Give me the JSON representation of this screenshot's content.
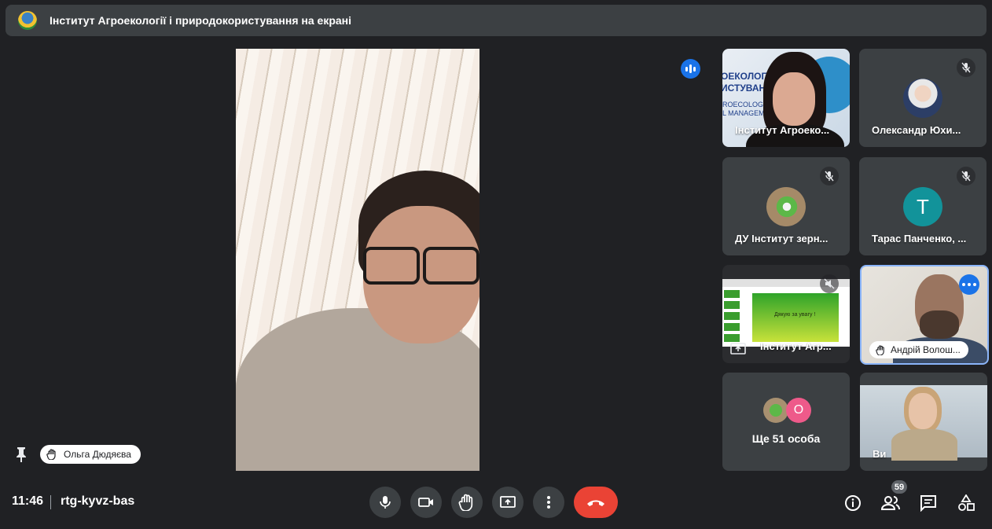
{
  "banner": {
    "title": "Інститут Агроекології і природокористування на екрані"
  },
  "main_speaker": {
    "name": "Ольга Дюдяєва"
  },
  "tiles": [
    {
      "name": "Інститут Агроеко...",
      "muted": false,
      "org_text": [
        "ОЕКОЛОГІ",
        "ИСТУВАНН"
      ],
      "org_text_en": [
        "ROECOLOGY",
        "L MANAGEMENT"
      ]
    },
    {
      "name": "Олександр Юхи...",
      "muted": true
    },
    {
      "name": "ДУ Інститут зерн...",
      "muted": true
    },
    {
      "name": "Тарас Панченко, ...",
      "muted": true,
      "avatar_letter": "T"
    },
    {
      "name": "Інститут Агр...",
      "muted": true,
      "presenting": true,
      "slide_text": "Дякую за увагу !"
    },
    {
      "name": "Андрій Волош...",
      "hand_raised": true
    },
    {
      "more_label": "Ще 51 особа",
      "avatar_letter": "О"
    },
    {
      "name": "Ви"
    }
  ],
  "meeting": {
    "time": "11:46",
    "code": "rtg-kyvz-bas"
  },
  "people_count": "59",
  "colors": {
    "background": "#202124",
    "tile": "#3c4043",
    "end_call": "#ea4335",
    "accent": "#1a73e8",
    "teal_avatar": "#12939a",
    "pink_avatar": "#ee5a8a"
  },
  "icons": {
    "controls": [
      "mic-icon",
      "camera-icon",
      "raise-hand-icon",
      "present-icon",
      "more-options-icon",
      "end-call-icon"
    ],
    "right": [
      "info-icon",
      "people-icon",
      "chat-icon",
      "activities-icon"
    ]
  }
}
